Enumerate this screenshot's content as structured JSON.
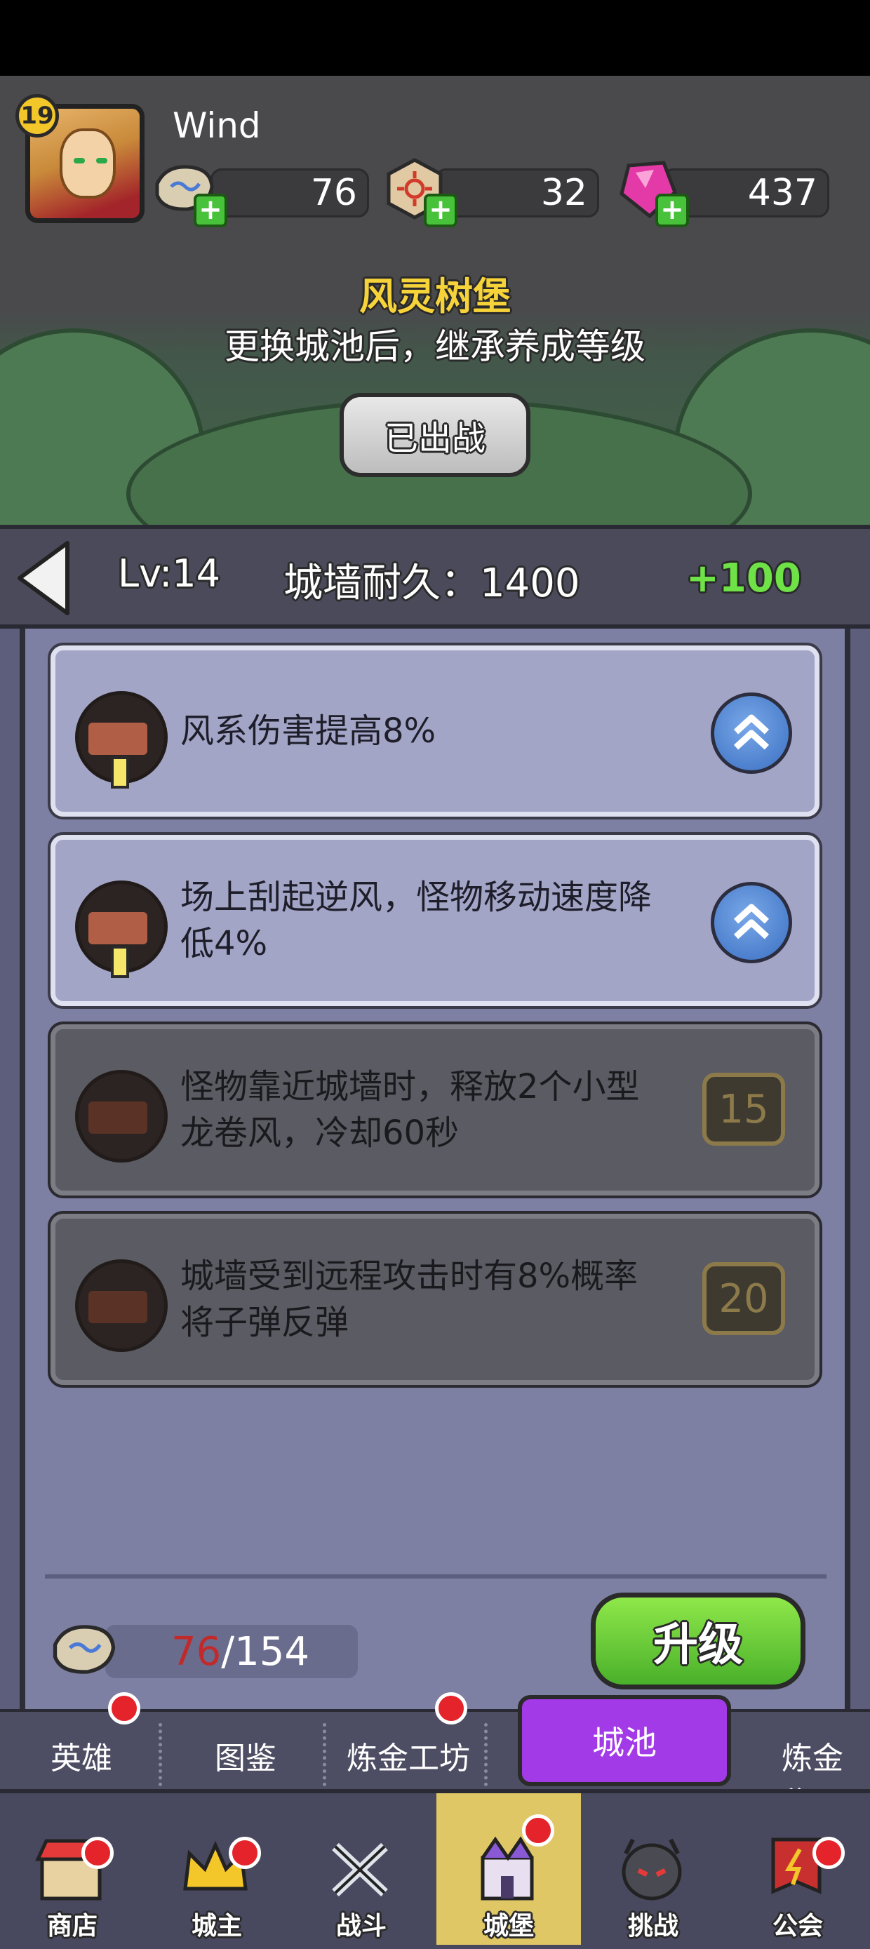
{
  "player": {
    "level": "19",
    "name": "Wind"
  },
  "resources": [
    {
      "icon": "rune-stone-icon",
      "value": "76"
    },
    {
      "icon": "sun-rune-icon",
      "value": "32"
    },
    {
      "icon": "pink-gem-icon",
      "value": "437"
    }
  ],
  "castle": {
    "name": "风灵树堡",
    "description": "更换城池后，继承养成等级",
    "deployed_label": "已出战"
  },
  "level_bar": {
    "level": "Lv:14",
    "wall_durability": "城墙耐久：1400",
    "bonus": "+100"
  },
  "skills": [
    {
      "text": "风系伤害提高8%",
      "unlocked": true
    },
    {
      "text": "场上刮起逆风，怪物移动速度降低4%",
      "unlocked": true
    },
    {
      "text": "怪物靠近城墙时，释放2个小型龙卷风，冷却60秒",
      "unlocked": false,
      "unlock_level": "15"
    },
    {
      "text": "城墙受到远程攻击时有8%概率将子弹反弹",
      "unlocked": false,
      "unlock_level": "20"
    }
  ],
  "upgrade": {
    "cost_have": "76",
    "cost_need": "/154",
    "button_label": "升级"
  },
  "sub_tabs": [
    "英雄",
    "图鉴",
    "炼金工坊",
    "城池",
    "炼金秘"
  ],
  "bottom_nav": [
    "商店",
    "城主",
    "战斗",
    "城堡",
    "挑战",
    "公会"
  ],
  "colors": {
    "accent_green": "#6ee246",
    "castle_name_gold": "#f7d33a",
    "active_tab_purple": "#a33ae8",
    "notification_red": "#e4232a"
  }
}
